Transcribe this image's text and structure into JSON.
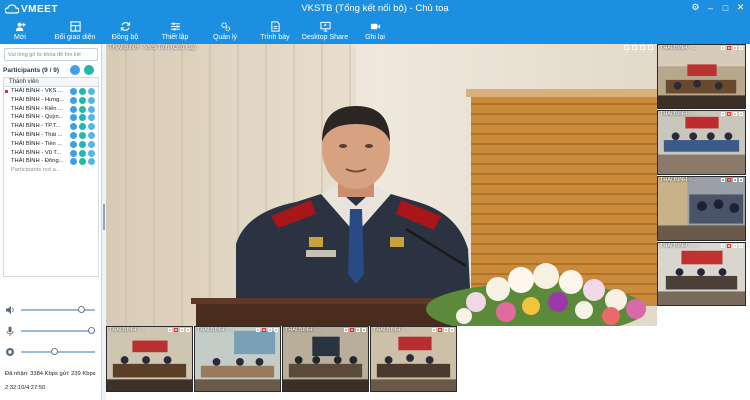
{
  "window": {
    "brand": "VMEET",
    "title": "VKSTB (Tổng kết nối bộ) - Chủ toạ"
  },
  "toolbar": [
    {
      "label": "Mới",
      "icon": "add-user-icon"
    },
    {
      "label": "Đổi giao diện",
      "icon": "layout-icon"
    },
    {
      "label": "Đồng bộ",
      "icon": "sync-icon"
    },
    {
      "label": "Thiết lập",
      "icon": "sliders-icon"
    },
    {
      "label": "Quản lý",
      "icon": "gears-icon"
    },
    {
      "label": "Trình bày",
      "icon": "presentation-icon"
    },
    {
      "label": "Desktop Share",
      "icon": "monitor-share-icon"
    },
    {
      "label": "Ghi lại",
      "icon": "record-icon"
    }
  ],
  "sidebar": {
    "search_placeholder": "Vui lòng gõ từ khóa để tìm kiế",
    "participants_title": "Participants (9 / 9)",
    "column_header": "Thành viên",
    "participants": [
      "THÁI BÌNH - VKS ...",
      "THÁI BÌNH - Hưng...",
      "THÁI BÌNH - Kiến ...",
      "THÁI BÌNH - Quỳn...",
      "THÁI BÌNH - TP.T...",
      "THÁI BÌNH - Thái ...",
      "THÁI BÌNH - Tiền ...",
      "THÁI BÌNH - Vũ T...",
      "THÁI BÌNH - Đông..."
    ],
    "footer_note": "Participants not a...",
    "speaker_level": 0.82,
    "mic_level": 0.95,
    "camera_level": 0.45,
    "stats": "Đã nhận: 3384 Kbps gửi: 239 Kbps",
    "clock": "2:32:10/4:27:50"
  },
  "main_video": {
    "label": "THÁI BÌNH - VKS Tỉnh (Chủ toạ)"
  },
  "right_thumbs": [
    {
      "label": "THÁI BÌNH - ..."
    },
    {
      "label": "THÁI BÌNH - ..."
    },
    {
      "label": "THÁI BÌNH - ..."
    },
    {
      "label": "THÁI BÌNH - ..."
    }
  ],
  "bottom_thumbs": [
    {
      "label": "THÁI BÌNH - ..."
    },
    {
      "label": "THÁI BÌNH - ..."
    },
    {
      "label": "THÁI BÌNH - ..."
    },
    {
      "label": "THÁI BÌNH - ..."
    }
  ],
  "colors": {
    "titlebar": "#1d8fe0",
    "accent_teal": "#20b8a8",
    "marker_red": "#d23333"
  }
}
